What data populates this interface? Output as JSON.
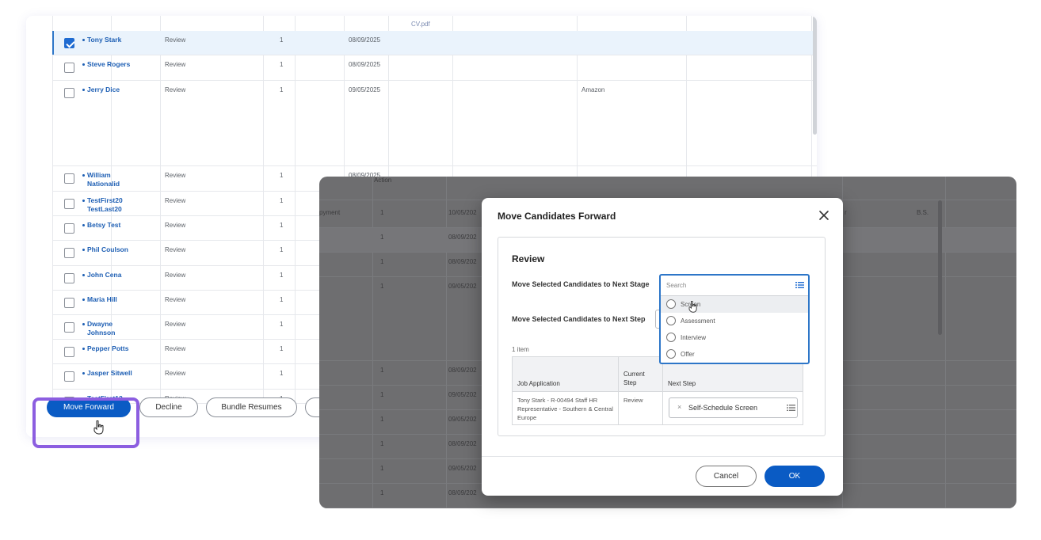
{
  "table": {
    "top_file": "CV.pdf",
    "rows": [
      {
        "name": "Tony Stark",
        "stage": "Review",
        "count": "1",
        "date": "08/09/2025",
        "company": "",
        "selected": true
      },
      {
        "name": "Steve Rogers",
        "stage": "Review",
        "count": "1",
        "date": "08/09/2025",
        "company": "",
        "selected": false
      },
      {
        "name": "Jerry Dice",
        "stage": "Review",
        "count": "1",
        "date": "09/05/2025",
        "company": "Amazon",
        "selected": false
      },
      {
        "name": "William Nationalid",
        "stage": "Review",
        "count": "1",
        "date": "08/09/2025",
        "company": "",
        "selected": false
      },
      {
        "name": "TestFirst20 TestLast20",
        "stage": "Review",
        "count": "1",
        "date": "",
        "company": "",
        "selected": false
      },
      {
        "name": "Betsy Test",
        "stage": "Review",
        "count": "1",
        "date": "",
        "company": "",
        "selected": false
      },
      {
        "name": "Phil Coulson",
        "stage": "Review",
        "count": "1",
        "date": "",
        "company": "",
        "selected": false
      },
      {
        "name": "John Cena",
        "stage": "Review",
        "count": "1",
        "date": "",
        "company": "",
        "selected": false
      },
      {
        "name": "Maria Hill",
        "stage": "Review",
        "count": "1",
        "date": "",
        "company": "",
        "selected": false
      },
      {
        "name": "Dwayne Johnson",
        "stage": "Review",
        "count": "1",
        "date": "",
        "company": "",
        "selected": false
      },
      {
        "name": "Pepper Potts",
        "stage": "Review",
        "count": "1",
        "date": "",
        "company": "",
        "selected": false
      },
      {
        "name": "Jasper Sitwell",
        "stage": "Review",
        "count": "1",
        "date": "",
        "company": "",
        "selected": false
      },
      {
        "name": "TestFirst12",
        "stage": "Review",
        "count": "1",
        "date": "",
        "company": "",
        "selected": false
      }
    ]
  },
  "actions": {
    "move_forward": "Move Forward",
    "decline": "Decline",
    "bundle_resumes": "Bundle Resumes"
  },
  "overlay": {
    "header_action": "Action",
    "row1_text": "pyment",
    "row1_count": "1",
    "row1_date": "10/05/202",
    "row1_right": "r",
    "row1_far_right": "B.S.",
    "dates": [
      "08/09/202",
      "08/09/202",
      "09/05/202",
      "08/09/202",
      "09/05/202",
      "09/05/202",
      "08/09/202",
      "09/05/202",
      "08/09/202",
      "09/05/202"
    ]
  },
  "modal": {
    "title": "Move Candidates Forward",
    "section_title": "Review",
    "next_stage_label": "Move Selected Candidates to Next Stage",
    "next_step_label": "Move Selected Candidates to Next Step",
    "item_count": "1 item",
    "search_placeholder": "Search",
    "options": [
      "Screen",
      "Assessment",
      "Interview",
      "Offer"
    ],
    "table_headers": {
      "job_application": "Job Application",
      "current_step": "Current Step",
      "next_step": "Next Step"
    },
    "table_row": {
      "job_application": "Tony Stark - R-00494 Staff HR Representative - Southern & Central Europe",
      "current_step": "Review",
      "next_step": "Self-Schedule Screen"
    },
    "cancel": "Cancel",
    "ok": "OK"
  },
  "colors": {
    "primary": "#0a5bc4",
    "link": "#1e5fb4",
    "highlight": "#8c5ee0",
    "focus": "#2d76c8"
  }
}
